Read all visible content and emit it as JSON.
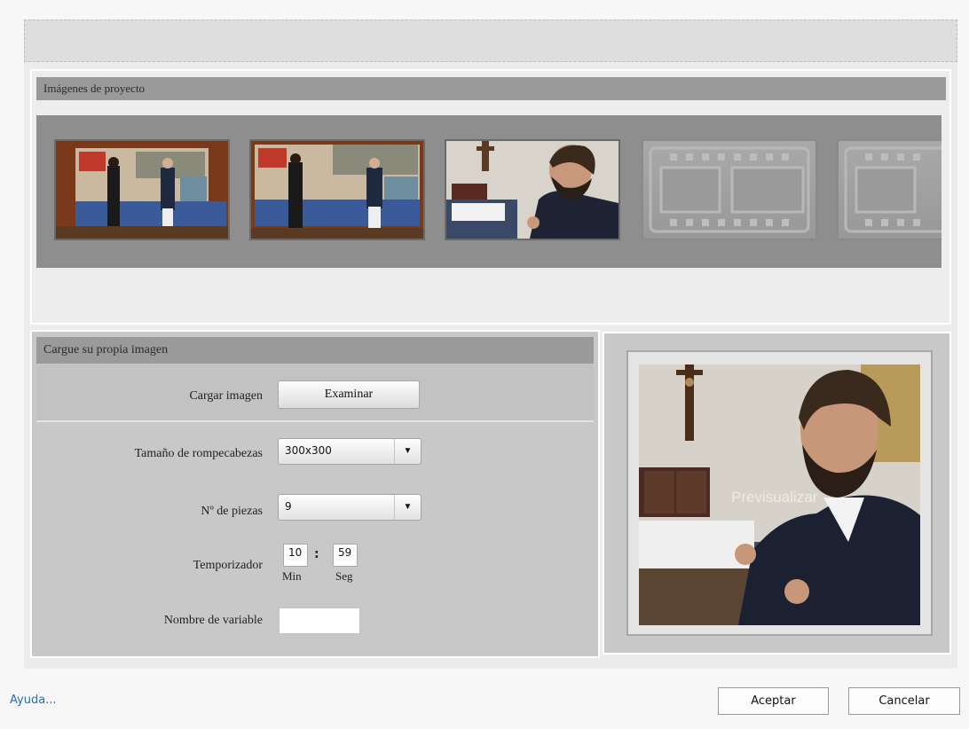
{
  "project_images": {
    "title": "Imágenes de proyecto",
    "thumbnails": [
      {
        "kind": "photo",
        "subject": "ceremony"
      },
      {
        "kind": "photo",
        "subject": "ceremony"
      },
      {
        "kind": "photo",
        "subject": "seated-man-writing"
      },
      {
        "kind": "empty",
        "icon": "film-strip-icon"
      },
      {
        "kind": "empty",
        "icon": "film-strip-icon"
      }
    ]
  },
  "upload": {
    "title": "Cargue su propia imagen",
    "load_label": "Cargar imagen",
    "browse_button": "Examinar",
    "size_label": "Tamaño de rompecabezas",
    "size_value": "300x300",
    "pieces_label": "Nº de piezas",
    "pieces_value": "9",
    "timer_label": "Temporizador",
    "timer_minutes": "10",
    "timer_seconds": "59",
    "timer_separator": ":",
    "minutes_unit": "Min",
    "seconds_unit": "Seg",
    "variable_label": "Nombre de variable",
    "variable_value": ""
  },
  "preview": {
    "label": "Previsualizar"
  },
  "footer": {
    "help_link": "Ayuda...",
    "accept_button": "Aceptar",
    "cancel_button": "Cancelar"
  },
  "colors": {
    "section_header": "#9a9a9a",
    "strip_background": "#8e8e8e",
    "link": "#2b6db3"
  }
}
